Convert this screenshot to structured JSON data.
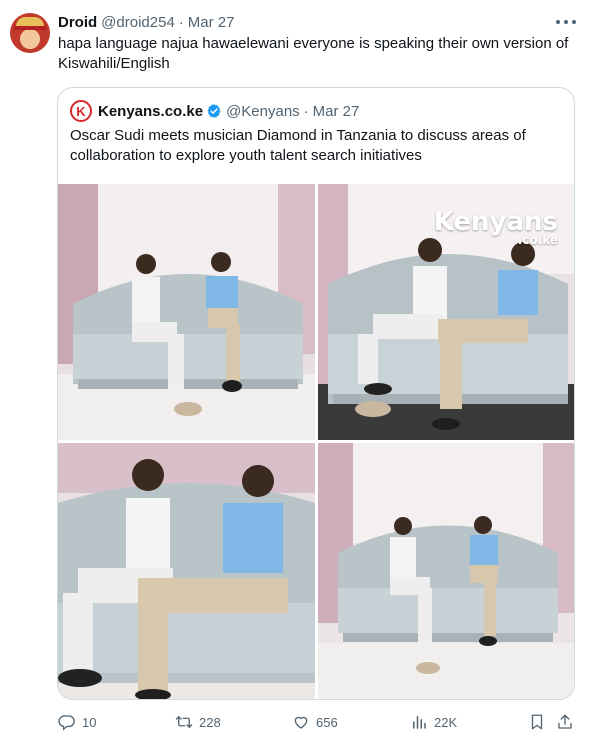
{
  "tweet": {
    "author_name": "Droid",
    "author_handle": "@droid254",
    "separator": "·",
    "date": "Mar 27",
    "text": "hapa language najua hawaelewani everyone is speaking their own version of Kiswahili/English",
    "avatar_icon": "one-piece-straw-hat-avatar",
    "more_icon": "more-horizontal-icon"
  },
  "quote": {
    "logo_letter": "K",
    "author_name": "Kenyans.co.ke",
    "verified_icon": "verified-badge-icon",
    "author_handle": "@Kenyans",
    "separator": "·",
    "date": "Mar 27",
    "text": "Oscar Sudi meets musician Diamond in Tanzania to discuss areas of collaboration to explore youth talent search initiatives",
    "photos": [
      {
        "alt": "Two men seated on an ornate sofa, wide shot"
      },
      {
        "alt": "Two men seated on an ornate sofa, relaxed pose",
        "watermark_main": "Kenyans",
        "watermark_sub": ".co.ke"
      },
      {
        "alt": "Two men seated on an ornate sofa, close shot"
      },
      {
        "alt": "Two men seated on an ornate sofa, distant shot"
      }
    ]
  },
  "actions": {
    "reply_count": "10",
    "retweet_count": "228",
    "like_count": "656",
    "views_count": "22K",
    "icons": [
      "reply-icon",
      "retweet-icon",
      "like-icon",
      "views-icon",
      "bookmark-icon",
      "share-icon"
    ]
  },
  "colors": {
    "text_primary": "#0f1419",
    "text_secondary": "#536471",
    "border": "#cfd9de",
    "verified_blue": "#1d9bf0",
    "brand_red": "#d62828"
  }
}
